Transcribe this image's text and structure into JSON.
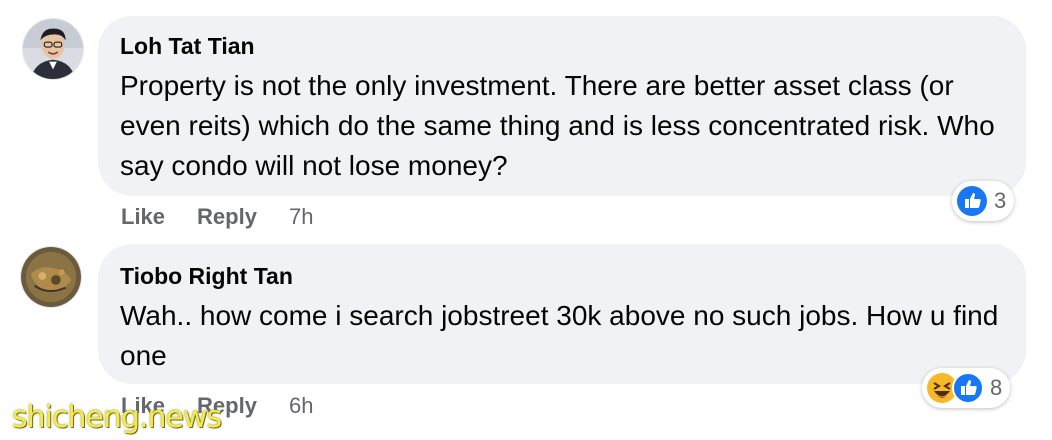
{
  "comments": [
    {
      "author": "Loh Tat Tian",
      "text": "Property is not the only investment. There are better asset class (or even reits) which do the same thing and is less concentrated risk. Who say condo will not lose money?",
      "like_label": "Like",
      "reply_label": "Reply",
      "time": "7h",
      "reaction_count": "3",
      "reactions": [
        "like-icon"
      ]
    },
    {
      "author": "Tiobo Right Tan",
      "text": "Wah.. how come i search jobstreet 30k above no such jobs. How u find one",
      "like_label": "Like",
      "reply_label": "Reply",
      "time": "6h",
      "reaction_count": "8",
      "reactions": [
        "haha-icon",
        "like-icon"
      ]
    }
  ],
  "watermark": "shicheng.news",
  "colors": {
    "bubble": "#f0f2f5",
    "muted": "#65676b",
    "like_blue": "#1877f2",
    "haha_yellow": "#f7b928"
  }
}
